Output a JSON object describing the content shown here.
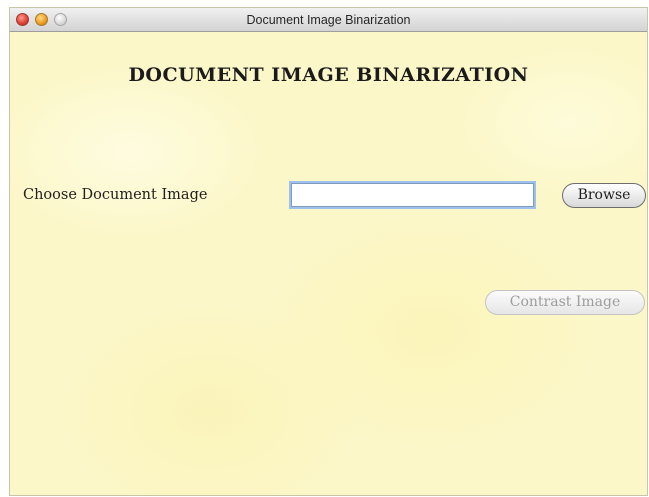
{
  "window": {
    "title": "Document Image Binarization"
  },
  "main": {
    "heading": "DOCUMENT IMAGE BINARIZATION",
    "choose_label": "Choose Document Image",
    "path_input": {
      "value": "",
      "placeholder": ""
    },
    "browse_label": "Browse",
    "contrast_label": "Contrast Image"
  }
}
